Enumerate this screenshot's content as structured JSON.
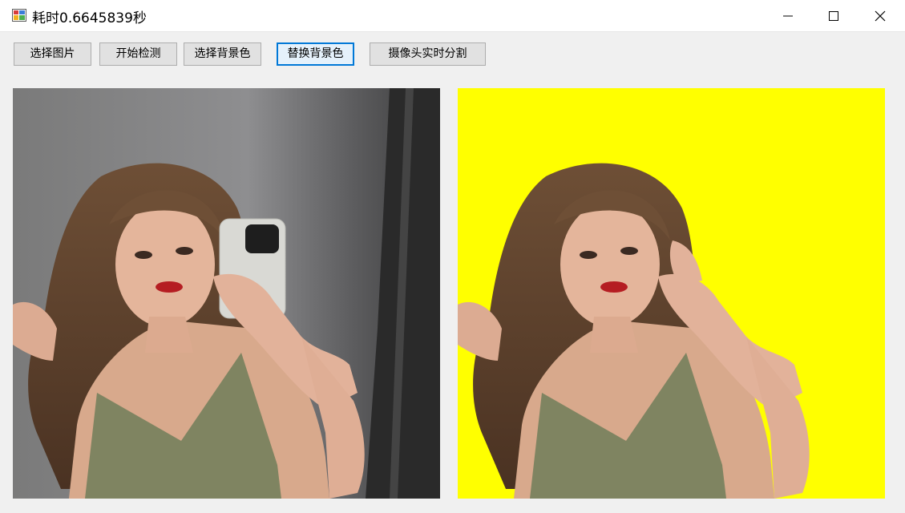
{
  "window": {
    "title": "耗时0.6645839秒",
    "icon": "app-window-icon",
    "controls": {
      "minimize_icon": "minimize-icon",
      "maximize_icon": "maximize-icon",
      "close_icon": "close-icon"
    }
  },
  "toolbar": {
    "buttons": [
      {
        "label": "选择图片"
      },
      {
        "label": "开始检测"
      },
      {
        "label": "选择背景色"
      },
      {
        "label": "替换背景色"
      },
      {
        "label": "摄像头实时分割"
      }
    ],
    "focused_index": 3
  },
  "images": {
    "original": {
      "description": "source-photo"
    },
    "result": {
      "background_color": "#ffff00"
    }
  },
  "colors": {
    "accent": "#0078d7",
    "replaced_background": "#ffff00"
  }
}
